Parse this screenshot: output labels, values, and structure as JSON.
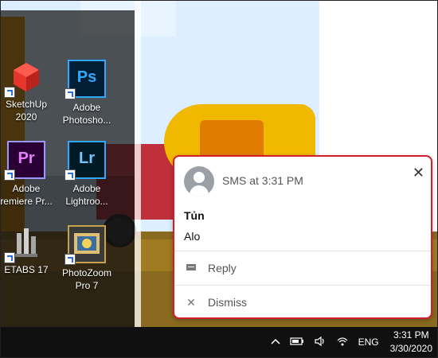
{
  "desktop": {
    "icons": [
      {
        "label_line1": "SketchUp",
        "label_line2": "2020",
        "icon": "sketchup-icon"
      },
      {
        "label_line1": "Adobe",
        "label_line2": "Photosho...",
        "icon": "photoshop-icon",
        "glyph": "Ps"
      },
      {
        "label_line1": "Adobe",
        "label_line2": "remiere Pr...",
        "icon": "premiere-icon",
        "glyph": "Pr"
      },
      {
        "label_line1": "Adobe",
        "label_line2": "Lightroo...",
        "icon": "lightroom-icon",
        "glyph": "Lr"
      },
      {
        "label_line1": "ETABS 17",
        "label_line2": "",
        "icon": "etabs-icon"
      },
      {
        "label_line1": "PhotoZoom",
        "label_line2": "Pro 7",
        "icon": "photozoom-icon"
      }
    ]
  },
  "notification": {
    "title": "SMS at 3:31 PM",
    "sender": "Tủn",
    "message": "Alo",
    "close_glyph": "✕",
    "actions": [
      {
        "label": "Reply",
        "icon": "reply-icon"
      },
      {
        "label": "Dismiss",
        "icon": "dismiss-icon"
      }
    ],
    "border_color": "#d21e2b"
  },
  "taskbar": {
    "language": "ENG",
    "time": "3:31 PM",
    "date": "3/30/2020"
  }
}
